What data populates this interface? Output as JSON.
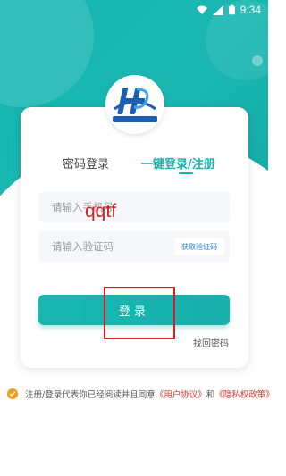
{
  "status_bar": {
    "time": "9:34"
  },
  "login": {
    "tabs": [
      {
        "label": "密码登录"
      },
      {
        "label": "一键登录/注册"
      }
    ],
    "phone_placeholder": "请输入手机号",
    "code_placeholder": "请输入验证码",
    "get_code_label": "获取验证码",
    "overlay_text": "qqtf",
    "login_label": "登录",
    "forgot_label": "找回密码"
  },
  "agreement": {
    "prefix": "注册/登录代表你已经阅读并且同意",
    "user_link": "《用户协议》",
    "and": "和",
    "privacy_link": "《隐私权政策》"
  },
  "colors": {
    "accent": "#18b2ad",
    "link_red": "#e2352b",
    "check_orange": "#f39a1f",
    "annotation_red": "#d11f26"
  },
  "icons": [
    "wifi-icon",
    "signal-icon",
    "battery-icon",
    "logo-icon",
    "checkbox-icon"
  ]
}
